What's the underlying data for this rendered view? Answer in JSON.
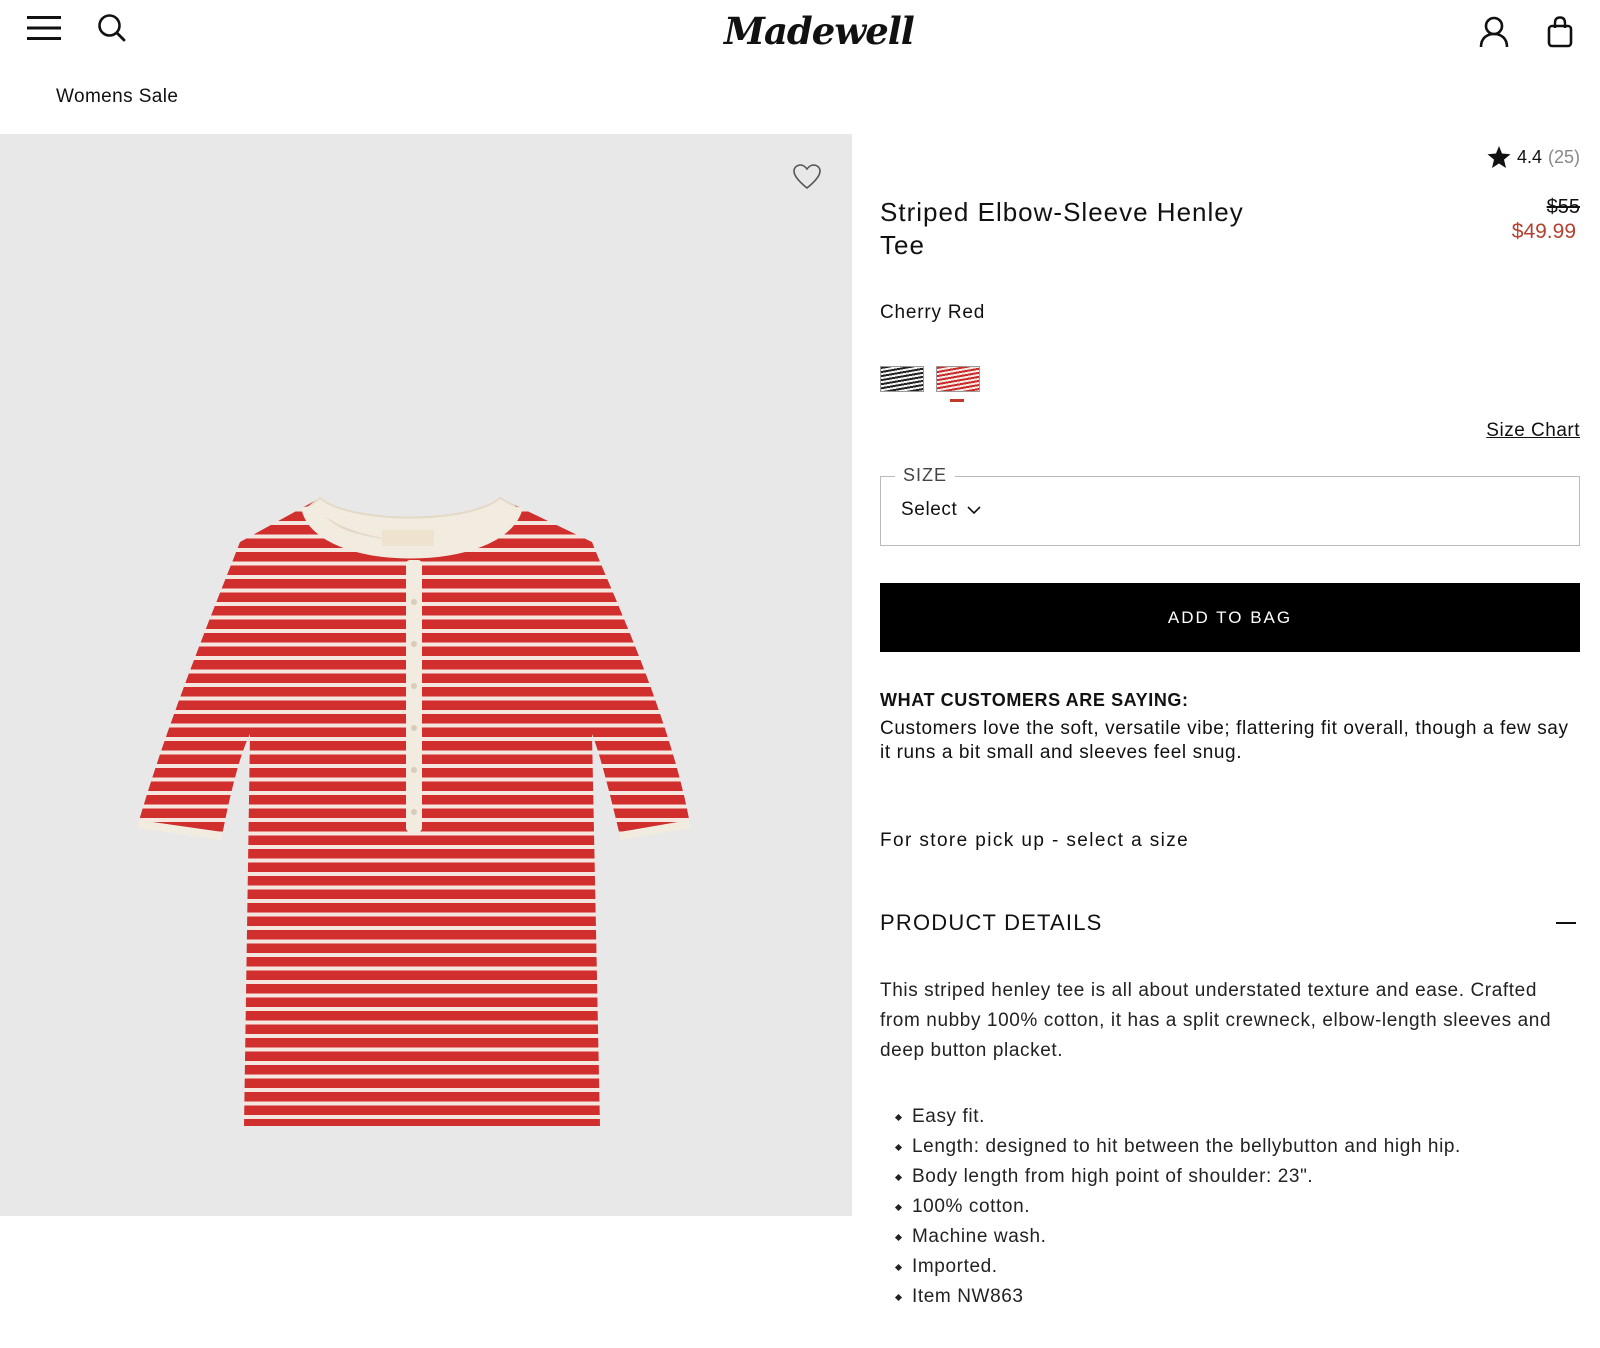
{
  "header": {
    "logo": "Madewell",
    "menu_icon": "hamburger-menu-icon",
    "search_icon": "search-icon",
    "account_icon": "user-icon",
    "bag_icon": "shopping-bag-icon"
  },
  "breadcrumb": "Womens Sale",
  "product": {
    "rating": "4.4",
    "review_count": "(25)",
    "title": "Striped Elbow-Sleeve Henley Tee",
    "price_original": "$55",
    "price_sale": "$49.99",
    "color_name": "Cherry Red",
    "swatches": [
      "navy-stripe",
      "cherry-red-stripe"
    ],
    "selected_swatch": "cherry-red-stripe",
    "size_chart_label": "Size Chart",
    "size_label": "SIZE",
    "size_value": "Select",
    "add_to_bag_label": "ADD TO BAG"
  },
  "reviews_summary": {
    "heading": "WHAT CUSTOMERS ARE SAYING:",
    "text": "Customers love the soft, versatile vibe; flattering fit overall, though a few say it runs a bit small and sleeves feel snug."
  },
  "pickup_text": "For store pick up - select a size",
  "details": {
    "heading": "PRODUCT DETAILS",
    "description": "This striped henley tee is all about understated texture and ease. Crafted from nubby 100% cotton, it has a split crewneck, elbow-length sleeves and deep button placket.",
    "bullets": [
      "Easy fit.",
      "Length: designed to hit between the bellybutton and high hip.",
      "Body length from high point of shoulder: 23\".",
      "100% cotton.",
      "Machine wash.",
      "Imported.",
      "Item NW863"
    ]
  },
  "colors": {
    "sale_red": "#b3412f",
    "gallery_bg": "#e8e8e8",
    "button_black": "#000000"
  }
}
